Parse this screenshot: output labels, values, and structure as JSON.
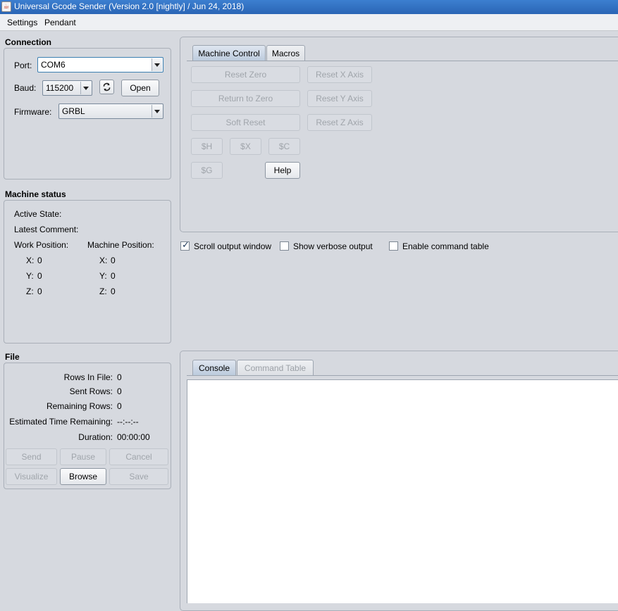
{
  "window": {
    "title": "Universal Gcode Sender (Version 2.0 [nightly]  / Jun 24, 2018)"
  },
  "menu": {
    "items": [
      "Settings",
      "Pendant"
    ]
  },
  "connection": {
    "title": "Connection",
    "port_label": "Port:",
    "port_value": "COM6",
    "baud_label": "Baud:",
    "baud_value": "115200",
    "open_label": "Open",
    "firmware_label": "Firmware:",
    "firmware_value": "GRBL"
  },
  "machine_status": {
    "title": "Machine status",
    "active_state_label": "Active State:",
    "latest_comment_label": "Latest Comment:",
    "work_position_label": "Work Position:",
    "machine_position_label": "Machine Position:",
    "work": {
      "x_label": "X:",
      "x": "0",
      "y_label": "Y:",
      "y": "0",
      "z_label": "Z:",
      "z": "0"
    },
    "machine": {
      "x_label": "X:",
      "x": "0",
      "y_label": "Y:",
      "y": "0",
      "z_label": "Z:",
      "z": "0"
    }
  },
  "file": {
    "title": "File",
    "rows_in_file_label": "Rows In File:",
    "rows_in_file": "0",
    "sent_rows_label": "Sent Rows:",
    "sent_rows": "0",
    "remaining_rows_label": "Remaining Rows:",
    "remaining_rows": "0",
    "est_time_label": "Estimated Time Remaining:",
    "est_time": "--:--:--",
    "duration_label": "Duration:",
    "duration": "00:00:00",
    "buttons": {
      "send": "Send",
      "pause": "Pause",
      "cancel": "Cancel",
      "visualize": "Visualize",
      "browse": "Browse",
      "save": "Save"
    }
  },
  "machine_control": {
    "tabs": {
      "machine_control": "Machine Control",
      "macros": "Macros"
    },
    "buttons": {
      "reset_zero": "Reset Zero",
      "return_to_zero": "Return to Zero",
      "soft_reset": "Soft Reset",
      "reset_x": "Reset X Axis",
      "reset_y": "Reset Y Axis",
      "reset_z": "Reset Z Axis",
      "home": "$H",
      "unlock": "$X",
      "check": "$C",
      "gcode": "$G",
      "help": "Help"
    }
  },
  "options": {
    "scroll_output": {
      "label": "Scroll output window",
      "checked": true
    },
    "verbose_output": {
      "label": "Show verbose output",
      "checked": false
    },
    "command_table": {
      "label": "Enable command table",
      "checked": false
    }
  },
  "console": {
    "tabs": {
      "console": "Console",
      "command_table": "Command Table"
    }
  }
}
